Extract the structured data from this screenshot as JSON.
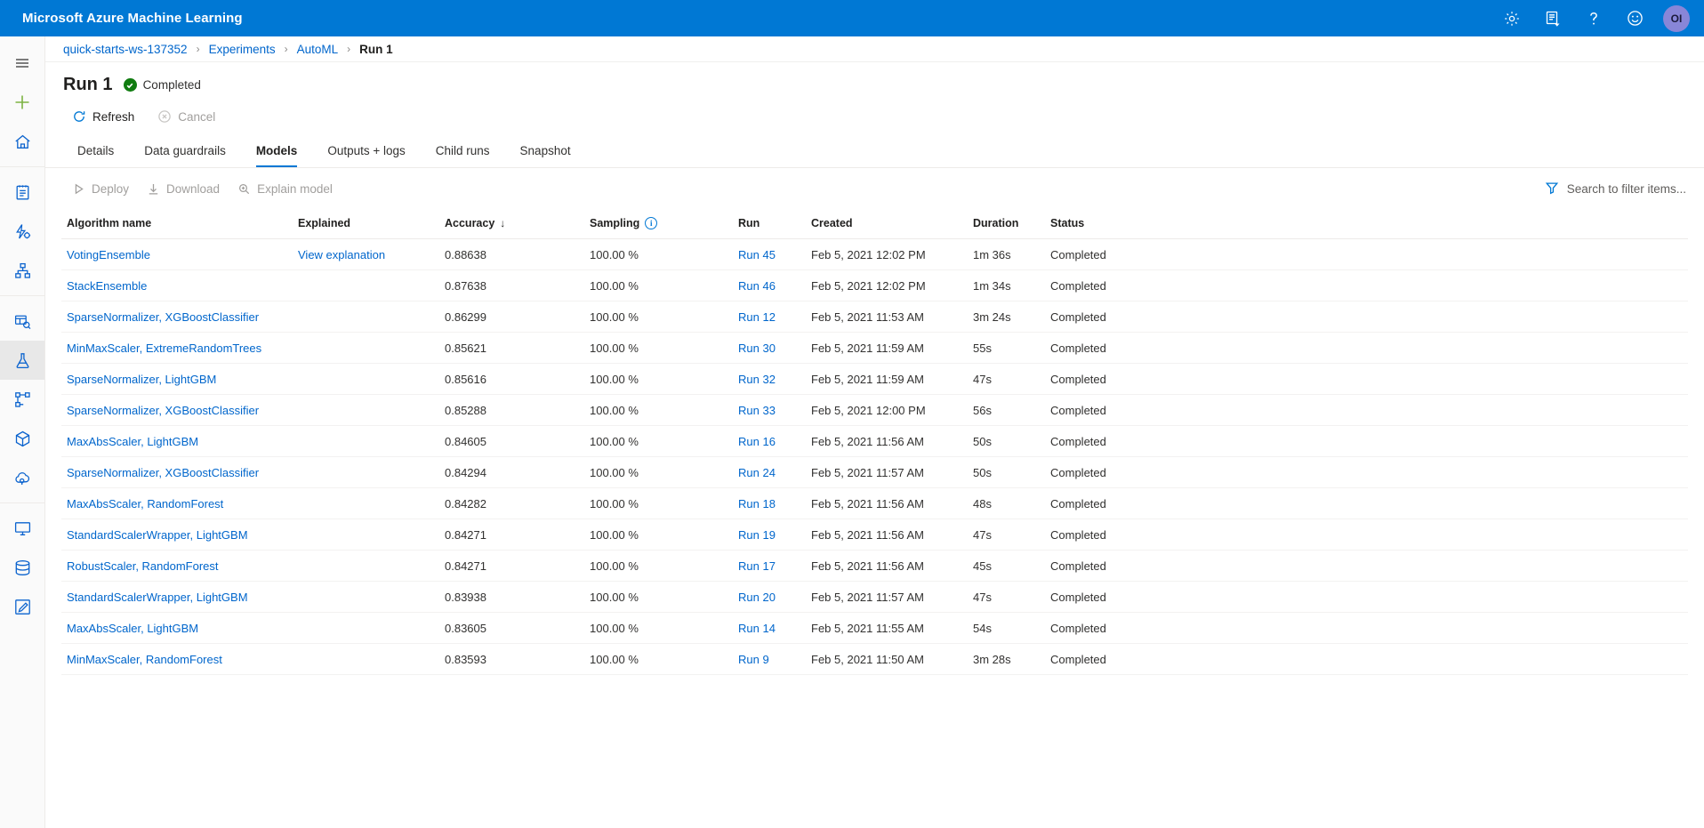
{
  "topbar": {
    "brand": "Microsoft Azure Machine Learning",
    "icons": [
      {
        "name": "gear-icon",
        "label": "Settings"
      },
      {
        "name": "feedback-notes-icon",
        "label": "Notes"
      },
      {
        "name": "help-question-icon",
        "label": "Help"
      },
      {
        "name": "smiley-feedback-icon",
        "label": "Feedback"
      }
    ],
    "avatar_initials": "OI"
  },
  "rail": {
    "items": [
      {
        "name": "hamburger-menu-icon",
        "label": "Menu",
        "active": false
      },
      {
        "name": "new-plus-icon",
        "label": "New",
        "active": false
      },
      {
        "name": "home-icon",
        "label": "Home",
        "active": false
      },
      {
        "name": "notebooks-icon",
        "label": "Notebooks",
        "active": false
      },
      {
        "name": "automated-ml-icon",
        "label": "Automated ML",
        "active": false
      },
      {
        "name": "designer-icon",
        "label": "Designer",
        "active": false
      },
      {
        "name": "datasets-icon",
        "label": "Datasets",
        "active": false
      },
      {
        "name": "experiments-flask-icon",
        "label": "Experiments",
        "active": true
      },
      {
        "name": "pipelines-icon",
        "label": "Pipelines",
        "active": false
      },
      {
        "name": "models-cube-icon",
        "label": "Models",
        "active": false
      },
      {
        "name": "endpoints-cloud-icon",
        "label": "Endpoints",
        "active": false
      },
      {
        "name": "compute-monitor-icon",
        "label": "Compute",
        "active": false
      },
      {
        "name": "datastores-icon",
        "label": "Datastores",
        "active": false
      },
      {
        "name": "labeling-icon",
        "label": "Data labeling",
        "active": false
      }
    ]
  },
  "breadcrumb": [
    {
      "label": "quick-starts-ws-137352",
      "current": false
    },
    {
      "label": "Experiments",
      "current": false
    },
    {
      "label": "AutoML",
      "current": false
    },
    {
      "label": "Run 1",
      "current": true
    }
  ],
  "breadcrumb_separator": "›",
  "header": {
    "title": "Run 1",
    "status": "Completed"
  },
  "commandbar": [
    {
      "name": "refresh-button",
      "label": "Refresh",
      "disabled": false
    },
    {
      "name": "cancel-button",
      "label": "Cancel",
      "disabled": true
    }
  ],
  "tabs": [
    {
      "label": "Details",
      "active": false
    },
    {
      "label": "Data guardrails",
      "active": false
    },
    {
      "label": "Models",
      "active": true
    },
    {
      "label": "Outputs + logs",
      "active": false
    },
    {
      "label": "Child runs",
      "active": false
    },
    {
      "label": "Snapshot",
      "active": false
    }
  ],
  "list_commands": [
    {
      "name": "deploy-button",
      "label": "Deploy",
      "disabled": true
    },
    {
      "name": "download-button",
      "label": "Download",
      "disabled": true
    },
    {
      "name": "explain-model-button",
      "label": "Explain model",
      "disabled": true
    }
  ],
  "filter": {
    "placeholder": "Search to filter items...",
    "value": ""
  },
  "table": {
    "columns": [
      {
        "key": "algorithm",
        "label": "Algorithm name"
      },
      {
        "key": "explained",
        "label": "Explained"
      },
      {
        "key": "accuracy",
        "label": "Accuracy",
        "sorted": "desc"
      },
      {
        "key": "sampling",
        "label": "Sampling",
        "info": true
      },
      {
        "key": "run",
        "label": "Run"
      },
      {
        "key": "created",
        "label": "Created"
      },
      {
        "key": "duration",
        "label": "Duration"
      },
      {
        "key": "status",
        "label": "Status"
      }
    ],
    "sort_arrow": "↓",
    "rows": [
      {
        "algorithm": "VotingEnsemble",
        "explained": "View explanation",
        "accuracy": "0.88638",
        "sampling": "100.00 %",
        "run": "Run 45",
        "created": "Feb 5, 2021 12:02 PM",
        "duration": "1m 36s",
        "status": "Completed"
      },
      {
        "algorithm": "StackEnsemble",
        "explained": "",
        "accuracy": "0.87638",
        "sampling": "100.00 %",
        "run": "Run 46",
        "created": "Feb 5, 2021 12:02 PM",
        "duration": "1m 34s",
        "status": "Completed"
      },
      {
        "algorithm": "SparseNormalizer, XGBoostClassifier",
        "explained": "",
        "accuracy": "0.86299",
        "sampling": "100.00 %",
        "run": "Run 12",
        "created": "Feb 5, 2021 11:53 AM",
        "duration": "3m 24s",
        "status": "Completed"
      },
      {
        "algorithm": "MinMaxScaler, ExtremeRandomTrees",
        "explained": "",
        "accuracy": "0.85621",
        "sampling": "100.00 %",
        "run": "Run 30",
        "created": "Feb 5, 2021 11:59 AM",
        "duration": "55s",
        "status": "Completed"
      },
      {
        "algorithm": "SparseNormalizer, LightGBM",
        "explained": "",
        "accuracy": "0.85616",
        "sampling": "100.00 %",
        "run": "Run 32",
        "created": "Feb 5, 2021 11:59 AM",
        "duration": "47s",
        "status": "Completed"
      },
      {
        "algorithm": "SparseNormalizer, XGBoostClassifier",
        "explained": "",
        "accuracy": "0.85288",
        "sampling": "100.00 %",
        "run": "Run 33",
        "created": "Feb 5, 2021 12:00 PM",
        "duration": "56s",
        "status": "Completed"
      },
      {
        "algorithm": "MaxAbsScaler, LightGBM",
        "explained": "",
        "accuracy": "0.84605",
        "sampling": "100.00 %",
        "run": "Run 16",
        "created": "Feb 5, 2021 11:56 AM",
        "duration": "50s",
        "status": "Completed"
      },
      {
        "algorithm": "SparseNormalizer, XGBoostClassifier",
        "explained": "",
        "accuracy": "0.84294",
        "sampling": "100.00 %",
        "run": "Run 24",
        "created": "Feb 5, 2021 11:57 AM",
        "duration": "50s",
        "status": "Completed"
      },
      {
        "algorithm": "MaxAbsScaler, RandomForest",
        "explained": "",
        "accuracy": "0.84282",
        "sampling": "100.00 %",
        "run": "Run 18",
        "created": "Feb 5, 2021 11:56 AM",
        "duration": "48s",
        "status": "Completed"
      },
      {
        "algorithm": "StandardScalerWrapper, LightGBM",
        "explained": "",
        "accuracy": "0.84271",
        "sampling": "100.00 %",
        "run": "Run 19",
        "created": "Feb 5, 2021 11:56 AM",
        "duration": "47s",
        "status": "Completed"
      },
      {
        "algorithm": "RobustScaler, RandomForest",
        "explained": "",
        "accuracy": "0.84271",
        "sampling": "100.00 %",
        "run": "Run 17",
        "created": "Feb 5, 2021 11:56 AM",
        "duration": "45s",
        "status": "Completed"
      },
      {
        "algorithm": "StandardScalerWrapper, LightGBM",
        "explained": "",
        "accuracy": "0.83938",
        "sampling": "100.00 %",
        "run": "Run 20",
        "created": "Feb 5, 2021 11:57 AM",
        "duration": "47s",
        "status": "Completed"
      },
      {
        "algorithm": "MaxAbsScaler, LightGBM",
        "explained": "",
        "accuracy": "0.83605",
        "sampling": "100.00 %",
        "run": "Run 14",
        "created": "Feb 5, 2021 11:55 AM",
        "duration": "54s",
        "status": "Completed"
      },
      {
        "algorithm": "MinMaxScaler, RandomForest",
        "explained": "",
        "accuracy": "0.83593",
        "sampling": "100.00 %",
        "run": "Run 9",
        "created": "Feb 5, 2021 11:50 AM",
        "duration": "3m 28s",
        "status": "Completed"
      }
    ]
  },
  "colors": {
    "brand_blue": "#0078d4",
    "link_blue": "#0066cc",
    "success_green": "#107c10",
    "avatar_purple": "#8886d8"
  }
}
